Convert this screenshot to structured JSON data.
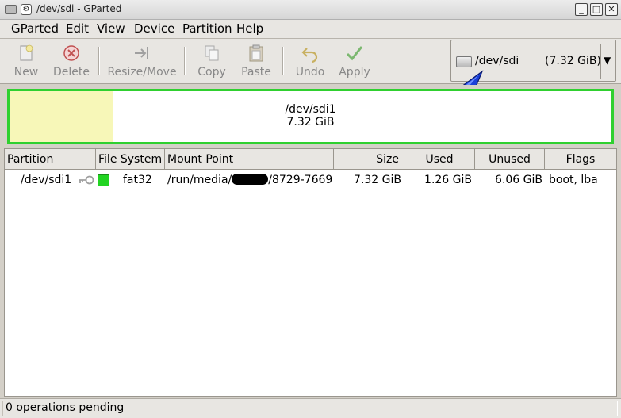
{
  "window": {
    "title": "/dev/sdi - GParted",
    "minimize_glyph": "_",
    "maximize_glyph": "□",
    "close_glyph": "✕"
  },
  "menu": {
    "items": [
      {
        "label": "GParted"
      },
      {
        "label": "Edit"
      },
      {
        "label": "View"
      },
      {
        "label": "Device"
      },
      {
        "label": "Partition"
      },
      {
        "label": "Help"
      }
    ]
  },
  "toolbar": {
    "new_label": "New",
    "delete_label": "Delete",
    "resize_label": "Resize/Move",
    "copy_label": "Copy",
    "paste_label": "Paste",
    "undo_label": "Undo",
    "apply_label": "Apply",
    "icons": {
      "new": "new-document-icon",
      "delete": "delete-icon",
      "resize": "resize-icon",
      "copy": "copy-icon",
      "paste": "paste-icon",
      "undo": "undo-icon",
      "apply": "checkmark-icon"
    }
  },
  "device_selector": {
    "device": "/dev/sdi",
    "size": "(7.32 GiB)"
  },
  "partition_map": {
    "name": "/dev/sdi1",
    "size": "7.32 GiB",
    "used_fraction": 0.172,
    "border_color": "#2fd02f",
    "used_color": "#f7f7b8"
  },
  "table": {
    "columns": {
      "partition": "Partition",
      "filesystem": "File System",
      "mountpoint": "Mount Point",
      "size": "Size",
      "used": "Used",
      "unused": "Unused",
      "flags": "Flags"
    },
    "rows": [
      {
        "partition": "/dev/sdi1",
        "filesystem": "fat32",
        "fs_color": "#22d422",
        "mount_prefix": "/run/media/",
        "mount_suffix": "/8729-7669",
        "size": "7.32 GiB",
        "used": "1.26 GiB",
        "unused": "6.06 GiB",
        "flags": "boot, lba"
      }
    ]
  },
  "status": {
    "text": "0 operations pending"
  }
}
